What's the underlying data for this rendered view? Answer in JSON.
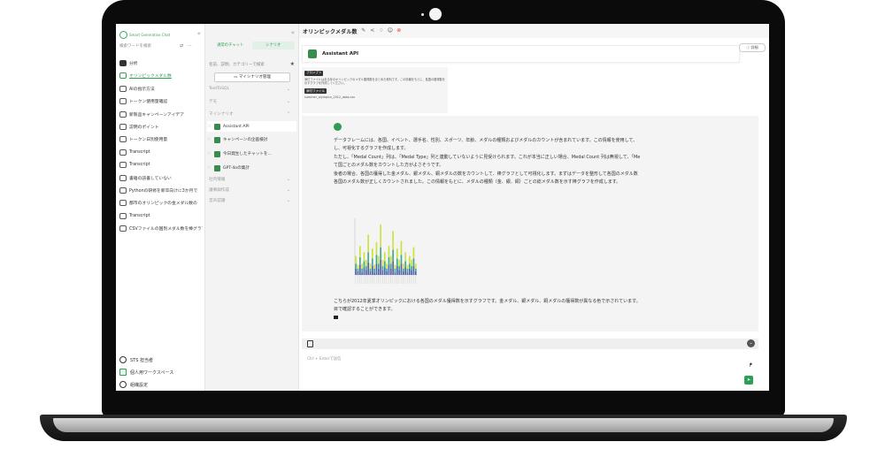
{
  "app": {
    "brand": "Smart Generative Chat",
    "search_placeholder": "検索ワードを検索"
  },
  "sidebar": {
    "items": [
      {
        "label": "分析",
        "type": "folder"
      },
      {
        "label": "オリンピックメダル数",
        "type": "chat",
        "active": true
      },
      {
        "label": "AIの指示方法",
        "type": "chat"
      },
      {
        "label": "トークン使用量確認",
        "type": "chat"
      },
      {
        "label": "新製品キャンペーンアイデア",
        "type": "chat"
      },
      {
        "label": "説明のポイント",
        "type": "chat"
      },
      {
        "label": "トークン日別使用量",
        "type": "chat"
      },
      {
        "label": "Transcript",
        "type": "chat"
      },
      {
        "label": "Transcript",
        "type": "chat"
      },
      {
        "label": "書籍の読書していない",
        "type": "chat"
      },
      {
        "label": "Pythonの研修を新卒向けに3か月で",
        "type": "chat"
      },
      {
        "label": "都市のオリンピックの金メダル数の",
        "type": "chat"
      },
      {
        "label": "Transcript",
        "type": "chat"
      },
      {
        "label": "CSVファイルの国別メダル数を棒グラフ",
        "type": "chat"
      }
    ],
    "footer": {
      "user": "STS 担当者",
      "workspace": "個人用ワークスペース",
      "settings": "組織設定"
    }
  },
  "panel": {
    "tabs": [
      "通常のチャット",
      "シナリオ"
    ],
    "search_placeholder": "名前、説明、カテゴリーで検索",
    "manage_button": "マイシナリオ管理",
    "sections": {
      "text_to_sql": "TextToSQL",
      "demo": "デモ",
      "my_scenario": "マイシナリオ",
      "internal": "社内情報",
      "reports": "議事録作成",
      "voice": "音声認識"
    },
    "scenarios": [
      "Assistant API",
      "キャンペーンの企画検討",
      "今日発生したチャットを...",
      "GPT-4oの集計"
    ]
  },
  "chat": {
    "title": "オリンピックメダル数",
    "bot_name": "Assistant API",
    "detail_button": "詳細",
    "prompt_badge": "プロンプト",
    "prompt_text": "添付ファイルはある年のオリンピックのメダル獲得数をまとめた資料です。この情報をもとに、各国の獲得数を示すグラフを作成してください。",
    "attachment_badge": "添付ファイル",
    "attachment_file": "summer_olympics_2012_data.csv",
    "response_paragraphs": [
      "データフレームには、各国、イベント、選手名、性別、スポーツ、年齢、メダルの種類およびメダルのカウントが含まれています。この情報を使用して、",
      "し、可視化するグラフを作成します。",
      "ただし、「Medal Count」列は、「Medal Type」列と連動していないように見受けられます。これが本当に正しい場合、Medal Count 列は無視して、「Me",
      "て国ごとのメダル数をカウントした方がよさそうです。",
      "後者の場合、各国の獲得した金メダル、銀メダル、銅メダルの数をカウントして、棒グラフとして可視化します。まずはデータを整形して各国のメダル数",
      "各国のメダル数が正しくカウントされました。この情報をもとに、メダルの種類（金、銀、銅）ごとの総メダル数を示す棒グラフを作成します。"
    ],
    "final_paragraphs": [
      "こちらが2012年夏季オリンピックにおける各国のメダル獲得数を示すグラフです。金メダル、銀メダル、銅メダルの獲得数が異なる色で示されています。",
      "目で確認することができます。"
    ],
    "input_placeholder": "Ctrl + Enterで送信"
  },
  "chart_data": {
    "type": "bar",
    "categories": [
      "c1",
      "c2",
      "c3",
      "c4",
      "c5",
      "c6",
      "c7",
      "c8",
      "c9",
      "c10",
      "c11",
      "c12",
      "c13",
      "c14",
      "c15",
      "c16",
      "c17",
      "c18",
      "c19",
      "c20",
      "c21",
      "c22",
      "c23",
      "c24",
      "c25",
      "c26",
      "c27",
      "c28",
      "c29",
      "c30"
    ],
    "series": [
      {
        "values": [
          5,
          3,
          8,
          2,
          6,
          4,
          10,
          3,
          7,
          2,
          9,
          5,
          12,
          4,
          6,
          3,
          8,
          5,
          11,
          2,
          7,
          4,
          9,
          3,
          6,
          2,
          5,
          4,
          7,
          3
        ]
      },
      {
        "values": [
          4,
          2,
          6,
          3,
          5,
          3,
          8,
          2,
          6,
          3,
          7,
          4,
          10,
          3,
          5,
          2,
          6,
          4,
          9,
          3,
          6,
          3,
          7,
          2,
          5,
          3,
          4,
          3,
          6,
          2
        ]
      },
      {
        "values": [
          6,
          3,
          9,
          4,
          7,
          5,
          14,
          4,
          8,
          3,
          10,
          6,
          18,
          5,
          7,
          4,
          9,
          6,
          15,
          3,
          8,
          5,
          11,
          4,
          7,
          3,
          6,
          5,
          9,
          4
        ]
      }
    ],
    "colors": [
      "#4b5fa8",
      "#3aa88a",
      "#cde03a"
    ],
    "ylim": [
      0,
      45
    ]
  }
}
